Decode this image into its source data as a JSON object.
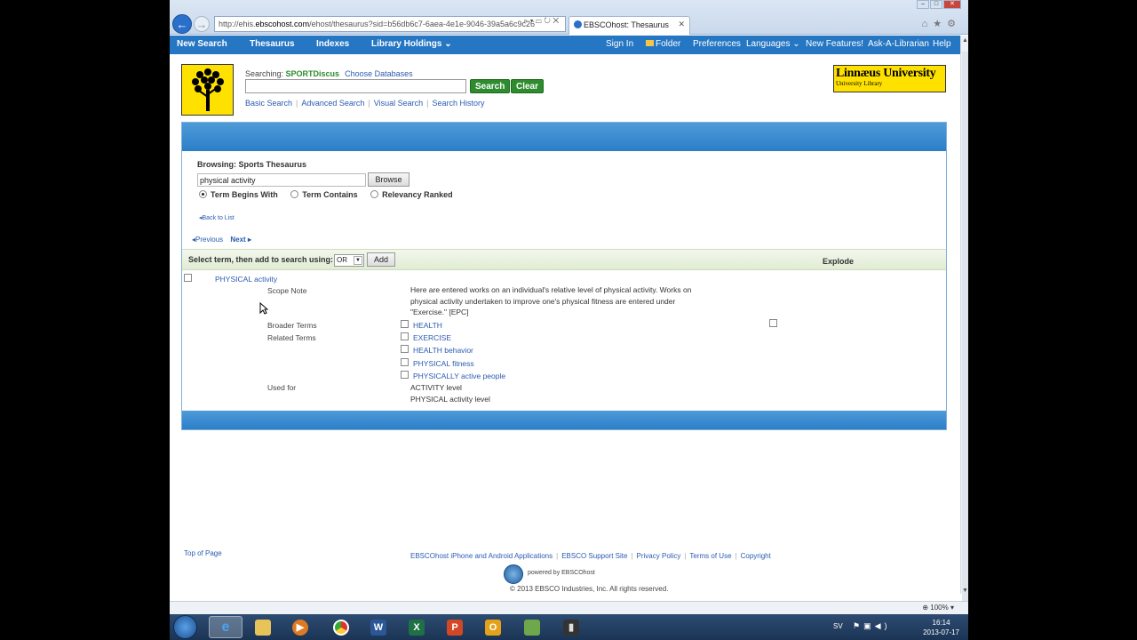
{
  "browser": {
    "address_prefix": "http://ehis.",
    "address_domain": "ebscohost.com",
    "address_rest": "/ehost/thesaurus?sid=b56db6c7-6aea-4e1e-9046-39a5a6c9c26",
    "tab_title": "EBSCOhost: Thesaurus",
    "zoom": "100%"
  },
  "topnav": {
    "new_search": "New Search",
    "thesaurus": "Thesaurus",
    "indexes": "Indexes",
    "library_holdings": "Library Holdings",
    "sign_in": "Sign In",
    "folder": "Folder",
    "preferences": "Preferences",
    "languages": "Languages",
    "new_features": "New Features!",
    "ask_librarian": "Ask-A-Librarian",
    "help": "Help"
  },
  "search": {
    "searching_label": "Searching:",
    "database": "SPORTDiscus",
    "choose_databases": "Choose Databases",
    "query": "",
    "search_button": "Search",
    "clear_button": "Clear",
    "basic_search": "Basic Search",
    "advanced_search": "Advanced Search",
    "visual_search": "Visual Search",
    "search_history": "Search History"
  },
  "institution": {
    "name": "Linnæus University",
    "subtitle": "University Library"
  },
  "browse": {
    "label": "Browsing: Sports Thesaurus",
    "input_value": "physical activity",
    "browse_button": "Browse",
    "options": [
      "Term Begins With",
      "Term Contains",
      "Relevancy Ranked"
    ],
    "selected_option": "Term Begins With",
    "back_to_list": "Back to List",
    "previous": "Previous",
    "next": "Next"
  },
  "select_bar": {
    "label": "Select term, then add to search using:",
    "operator": "OR",
    "add_button": "Add",
    "explode_header": "Explode"
  },
  "term": {
    "name": "PHYSICAL activity",
    "scope_note_label": "Scope Note",
    "scope_note": "Here are entered works on an individual's relative level of physical activity. Works on physical activity undertaken to improve one's physical fitness are entered under \"Exercise.\" [EPC]",
    "broader_label": "Broader Terms",
    "broader_terms": [
      "HEALTH"
    ],
    "related_label": "Related Terms",
    "related_terms": [
      "EXERCISE",
      "HEALTH behavior",
      "PHYSICAL fitness",
      "PHYSICALLY active people"
    ],
    "used_for_label": "Used for",
    "used_for": [
      "ACTIVITY level",
      "PHYSICAL activity level"
    ]
  },
  "footer": {
    "top_of_page": "Top of Page",
    "links": [
      "EBSCOhost iPhone and Android Applications",
      "EBSCO Support Site",
      "Privacy Policy",
      "Terms of Use",
      "Copyright"
    ],
    "powered_by": "powered by EBSCOhost",
    "copyright": "© 2013 EBSCO Industries, Inc. All rights reserved."
  },
  "taskbar": {
    "language": "SV",
    "time": "16:14",
    "date": "2013-07-17"
  },
  "colors": {
    "nav_blue": "#2576c3",
    "panel_blue": "#2b7ec8",
    "search_green": "#2e8b2e",
    "link_blue": "#2b5bb0",
    "logo_yellow": "#ffe100"
  }
}
